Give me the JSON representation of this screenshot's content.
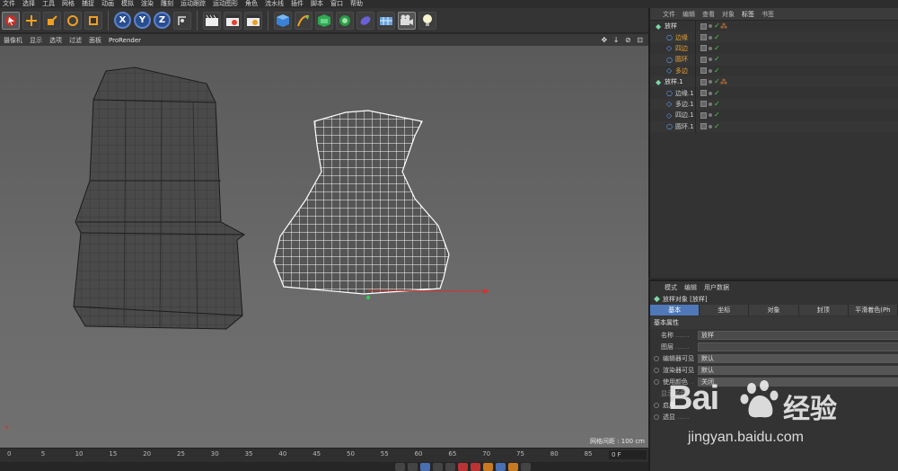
{
  "menu": [
    "文件",
    "选择",
    "工具",
    "网格",
    "捕捉",
    "动画",
    "模拟",
    "渲染",
    "雕刻",
    "运动跟踪",
    "运动图形",
    "角色",
    "流水线",
    "插件",
    "脚本",
    "窗口",
    "帮助"
  ],
  "toolbar": {
    "axis_x": "X",
    "axis_y": "Y",
    "axis_z": "Z"
  },
  "viewport": {
    "menu": [
      "摄像机",
      "显示",
      "选项",
      "过滤",
      "面板",
      "ProRender"
    ],
    "grid_label": "网格间距 : 100 cm"
  },
  "timeline": {
    "ticks": [
      "0",
      "5",
      "10",
      "15",
      "20",
      "25",
      "30",
      "35",
      "40",
      "45",
      "50",
      "55",
      "60",
      "65",
      "70",
      "75",
      "80",
      "85",
      "90"
    ],
    "frame": "0 F"
  },
  "object_manager": {
    "tabs": [
      "文件",
      "编辑",
      "查看",
      "对象",
      "标签",
      "书签"
    ],
    "objects": [
      {
        "name": "放样",
        "level": 0,
        "kind": "loft",
        "color": "#e0e0e0"
      },
      {
        "name": "边缘",
        "level": 1,
        "kind": "circle",
        "color": "#e8a030"
      },
      {
        "name": "四边",
        "level": 1,
        "kind": "diamond",
        "color": "#e8a030"
      },
      {
        "name": "圆环",
        "level": 1,
        "kind": "circle",
        "color": "#e8a030"
      },
      {
        "name": "多边",
        "level": 1,
        "kind": "diamond",
        "color": "#e8a030"
      },
      {
        "name": "放样.1",
        "level": 0,
        "kind": "loft",
        "color": "#e0e0e0"
      },
      {
        "name": "边缘.1",
        "level": 1,
        "kind": "circle",
        "color": "#d0d0d0"
      },
      {
        "name": "多边.1",
        "level": 1,
        "kind": "diamond",
        "color": "#d0d0d0"
      },
      {
        "name": "四边.1",
        "level": 1,
        "kind": "diamond",
        "color": "#d0d0d0"
      },
      {
        "name": "圆环.1",
        "level": 1,
        "kind": "circle",
        "color": "#d0d0d0"
      }
    ]
  },
  "attribute_manager": {
    "tabs": [
      "模式",
      "编辑",
      "用户数据"
    ],
    "title": "放样对象 [放样]",
    "subtabs": [
      "基本",
      "坐标",
      "对象",
      "封顶",
      "平滑着色(Ph"
    ],
    "section": "基本属性",
    "props": [
      {
        "label": "名称",
        "value": "放样",
        "radio": false,
        "dim": false,
        "dots": "......."
      },
      {
        "label": "图层",
        "value": "",
        "radio": false,
        "dim": false,
        "dots": "......."
      },
      {
        "label": "编辑器可见",
        "value": "默认",
        "radio": true,
        "dim": false,
        "dots": ""
      },
      {
        "label": "渲染器可见",
        "value": "默认",
        "radio": true,
        "dim": false,
        "dots": ""
      },
      {
        "label": "使用颜色",
        "value": "关闭",
        "radio": true,
        "dim": false,
        "dots": "."
      },
      {
        "label": "显示颜色",
        "value": "",
        "radio": false,
        "dim": true,
        "dots": ""
      },
      {
        "label": "启用",
        "value": "",
        "radio": true,
        "dim": false,
        "dots": "......"
      },
      {
        "label": "透显",
        "value": "",
        "radio": true,
        "dim": false,
        "dots": "......"
      }
    ]
  },
  "watermark": {
    "brand": "Bai",
    "brand_cn": "经验",
    "url": "jingyan.baidu.com"
  },
  "colors": {
    "accent_blue": "#4f78b9",
    "viewport_bg": "#636363",
    "selected_obj": "#e8a030"
  }
}
